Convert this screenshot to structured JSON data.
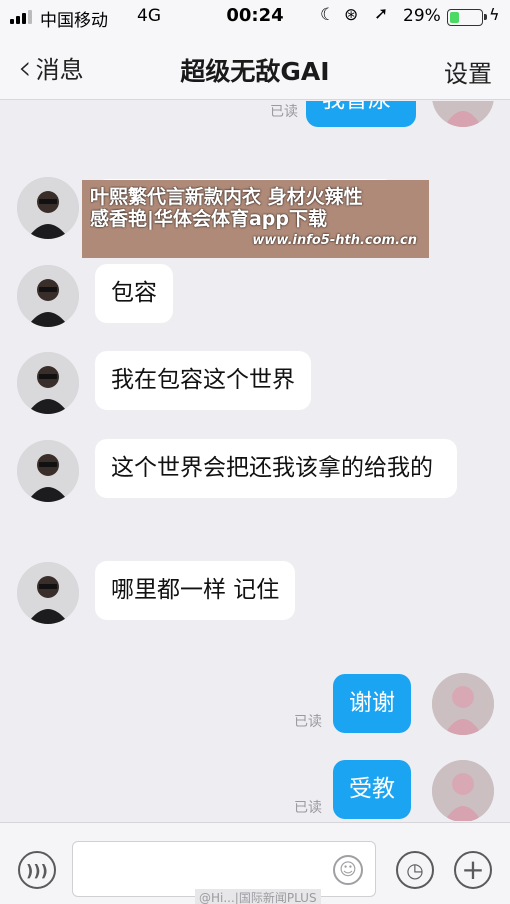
{
  "status_bar": {
    "carrier": "中国移动",
    "network": "4G",
    "time": "00:24",
    "battery_percent": "29%",
    "battery_level": 0.29,
    "icons": [
      "signal-icon",
      "moon-icon",
      "rotation-lock-icon",
      "location-arrow-icon",
      "battery-icon",
      "charging-icon"
    ]
  },
  "nav": {
    "back_label": "消息",
    "title": "超级无敌GAI",
    "settings_label": "设置"
  },
  "messages": [
    {
      "from": "me",
      "text": "我冒尿",
      "status": "已读"
    },
    {
      "from": "friend",
      "text": ""
    },
    {
      "from": "friend",
      "text": "包容"
    },
    {
      "from": "friend",
      "text": "我在包容这个世界"
    },
    {
      "from": "friend",
      "text": "这个世界会把还我该拿的给我的"
    },
    {
      "from": "friend",
      "text": "哪里都一样 记住"
    },
    {
      "from": "me",
      "text": "谢谢",
      "status": "已读"
    },
    {
      "from": "me",
      "text": "受教",
      "status": "已读"
    }
  ],
  "ad_banner": {
    "line1": "叶熙繁代言新款内衣 身材火辣性",
    "line2": "感香艳|华体会体育app下载",
    "url": "www.info5-hth.com.cn"
  },
  "input_bar": {
    "placeholder": "",
    "watermark": "@Hi...|国际新闻PLUS"
  },
  "colors": {
    "outgoing_bubble": "#1aa4f2",
    "incoming_bubble": "#ffffff",
    "background": "#eeeef2"
  }
}
